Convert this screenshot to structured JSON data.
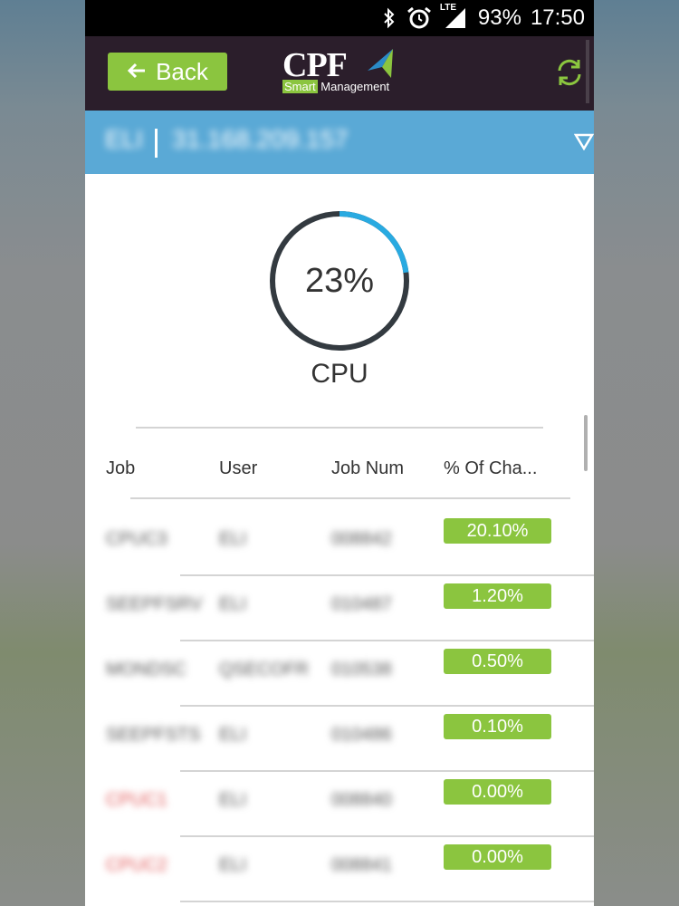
{
  "status_bar": {
    "bluetooth_icon": "bluetooth-icon",
    "alarm_icon": "alarm-clock-icon",
    "network_label": "LTE",
    "battery": "93%",
    "time": "17:50"
  },
  "header": {
    "back_label": "Back",
    "back_icon": "arrow-left-icon",
    "logo_text": "CPF",
    "logo_sub_smart": "Smart",
    "logo_sub_rest": " Management",
    "refresh_icon": "refresh-icon"
  },
  "server": {
    "name": "ELI",
    "address": "31.168.209.157",
    "dropdown_icon": "triangle-down-icon"
  },
  "gauge": {
    "value_text": "23%",
    "percent": 23,
    "label": "CPU",
    "track_color": "#333a40",
    "fill_color": "#29aae1"
  },
  "table": {
    "columns": [
      "Job",
      "User",
      "Job Num",
      "% Of Cha..."
    ],
    "rows": [
      {
        "job": "CPUC3",
        "user": "ELI",
        "job_num": "008842",
        "percent": "20.10%",
        "job_red": false
      },
      {
        "job": "SEEPFSRV",
        "user": "ELI",
        "job_num": "010487",
        "percent": "1.20%",
        "job_red": false
      },
      {
        "job": "MONDSC",
        "user": "QSECOFR",
        "job_num": "010538",
        "percent": "0.50%",
        "job_red": false
      },
      {
        "job": "SEEPFSTS",
        "user": "ELI",
        "job_num": "010486",
        "percent": "0.10%",
        "job_red": false
      },
      {
        "job": "CPUC1",
        "user": "ELI",
        "job_num": "008840",
        "percent": "0.00%",
        "job_red": true
      },
      {
        "job": "CPUC2",
        "user": "ELI",
        "job_num": "008841",
        "percent": "0.00%",
        "job_red": true
      }
    ]
  },
  "colors": {
    "header_bg": "#2b1e2b",
    "accent_green": "#8bc53f",
    "server_bar": "#5aa9d6"
  }
}
